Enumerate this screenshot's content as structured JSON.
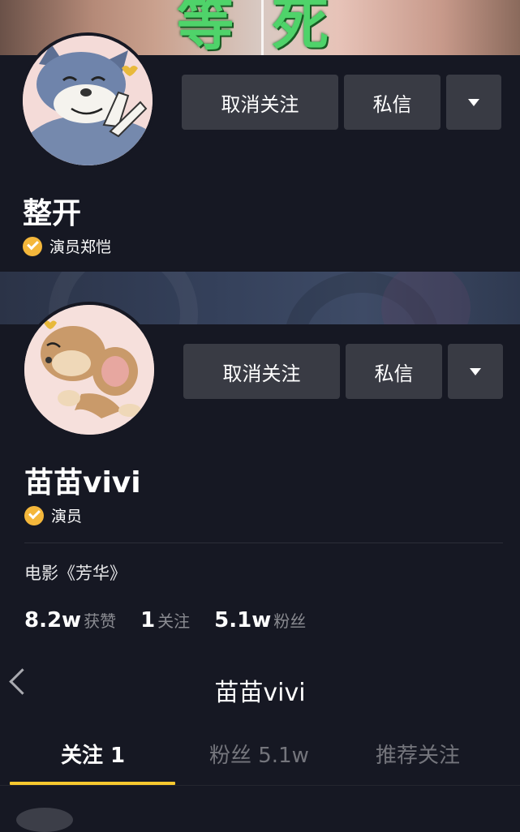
{
  "panel1": {
    "cover_text": [
      "等",
      "死"
    ],
    "follow_button": "取消关注",
    "message_button": "私信",
    "username": "整开",
    "verified_label": "演员郑恺"
  },
  "panel2": {
    "follow_button": "取消关注",
    "message_button": "私信",
    "username": "苗苗vivi",
    "verified_label": "演员",
    "bio": "电影《芳华》",
    "stats": [
      {
        "value": "8.2w",
        "label": "获赞"
      },
      {
        "value": "1",
        "label": "关注"
      },
      {
        "value": "5.1w",
        "label": "粉丝"
      }
    ]
  },
  "panel3": {
    "title": "苗苗vivi",
    "tabs": [
      {
        "label": "关注 1",
        "active": true
      },
      {
        "label": "粉丝 5.1w",
        "active": false
      },
      {
        "label": "推荐关注",
        "active": false
      }
    ]
  },
  "colors": {
    "background": "#161823",
    "button": "#393b44",
    "verified_badge": "#f4b73b",
    "tab_underline": "#f7c82f",
    "muted_text": "#8a8b91"
  }
}
